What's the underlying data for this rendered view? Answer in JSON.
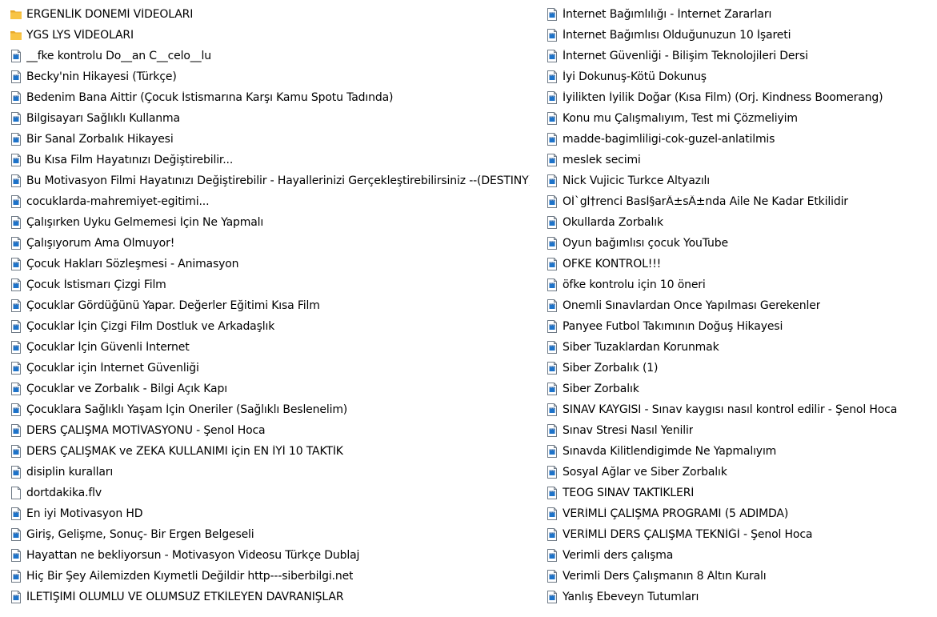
{
  "colors": {
    "folder": "#F8C445",
    "video_icon": "#1E73C9"
  },
  "files_left": [
    {
      "name": "ERGENLİK DÖNEMİ VİDEOLARI",
      "icon": "folder-icon"
    },
    {
      "name": "YGS LYS VİDEOLARI",
      "icon": "folder-icon"
    },
    {
      "name": "__fke kontrolu Do__an C__celo__lu",
      "icon": "video-file-icon"
    },
    {
      "name": "Becky'nin Hikayesi (Türkçe)",
      "icon": "video-file-icon"
    },
    {
      "name": "Bedenim Bana Aittir (Çocuk İstismarına Karşı Kamu Spotu Tadında)",
      "icon": "video-file-icon"
    },
    {
      "name": "Bilgisayarı Sağlıklı Kullanma",
      "icon": "video-file-icon"
    },
    {
      "name": "Bir Sanal Zorbalık Hikayesi",
      "icon": "video-file-icon"
    },
    {
      "name": "Bu Kısa Film Hayatınızı Değiştirebilir...",
      "icon": "video-file-icon"
    },
    {
      "name": "Bu Motivasyon Filmi Hayatınızı Değiştirebilir - Hayallerinizi Gerçekleştirebilirsiniz --(DESTINY)-",
      "icon": "video-file-icon"
    },
    {
      "name": "cocuklarda-mahremiyet-egitimi...",
      "icon": "video-file-icon"
    },
    {
      "name": "Çalışırken Uyku Gelmemesi İçin Ne Yapmalı",
      "icon": "video-file-icon"
    },
    {
      "name": "Çalışıyorum Ama Olmuyor!",
      "icon": "video-file-icon"
    },
    {
      "name": "Çocuk Hakları Sözleşmesi - Animasyon",
      "icon": "video-file-icon"
    },
    {
      "name": "Çocuk İstismarı Çizgi Film",
      "icon": "video-file-icon"
    },
    {
      "name": "Çocuklar Gördüğünü Yapar. Değerler Eğitimi Kısa Film",
      "icon": "video-file-icon"
    },
    {
      "name": "Çocuklar İçin Çizgi Film Dostluk ve Arkadaşlık",
      "icon": "video-file-icon"
    },
    {
      "name": "Çocuklar İçin Güvenli İnternet",
      "icon": "video-file-icon"
    },
    {
      "name": "Çocuklar için İnternet Güvenliği",
      "icon": "video-file-icon"
    },
    {
      "name": "Çocuklar ve Zorbalık - Bilgi Açık Kapı",
      "icon": "video-file-icon"
    },
    {
      "name": "Çocuklara Sağlıklı Yaşam İçin Öneriler (Sağlıklı Beslenelim)",
      "icon": "video-file-icon"
    },
    {
      "name": "DERS ÇALIŞMA MOTİVASYONU - Şenol Hoca",
      "icon": "video-file-icon"
    },
    {
      "name": "DERS ÇALIŞMAK ve ZEKA KULLANIMI için EN İYİ 10 TAKTİK",
      "icon": "video-file-icon"
    },
    {
      "name": "disiplin kuralları",
      "icon": "video-file-icon"
    },
    {
      "name": "dortdakika.flv",
      "icon": "blank-file-icon"
    },
    {
      "name": "En iyi Motivasyon HD",
      "icon": "video-file-icon"
    },
    {
      "name": "Giriş, Gelişme, Sonuç- Bir Ergen Belgeseli",
      "icon": "video-file-icon"
    },
    {
      "name": "Hayattan ne bekliyorsun  - Motivasyon Videosu Türkçe Dublaj",
      "icon": "video-file-icon"
    },
    {
      "name": "Hiç Bir Şey Ailemizden Kıymetli Değildir http---siberbilgi.net",
      "icon": "video-file-icon"
    },
    {
      "name": "İLETİŞİMİ OLUMLU VE OLUMSUZ ETKİLEYEN DAVRANIŞLAR",
      "icon": "video-file-icon"
    }
  ],
  "files_right": [
    {
      "name": "İnternet Bağımlılığı - İnternet Zararları",
      "icon": "video-file-icon"
    },
    {
      "name": "İnternet Bağımlısı Olduğunuzun 10 İşareti",
      "icon": "video-file-icon"
    },
    {
      "name": "İnternet Güvenliği - Bilişim Teknolojileri Dersi",
      "icon": "video-file-icon"
    },
    {
      "name": "İyi Dokunuş-Kötü Dokunuş",
      "icon": "video-file-icon"
    },
    {
      "name": "İyilikten İyilik Doğar (Kısa Film)  (Orj. Kindness Boomerang)",
      "icon": "video-file-icon"
    },
    {
      "name": "Konu mu Çalışmalıyım, Test mi Çözmeliyim",
      "icon": "video-file-icon"
    },
    {
      "name": "madde-bagimliligi-cok-guzel-anlatilmis",
      "icon": "video-file-icon"
    },
    {
      "name": "meslek secimi",
      "icon": "video-file-icon"
    },
    {
      "name": "Nick Vujicic Turkce Altyazılı",
      "icon": "video-file-icon"
    },
    {
      "name": "Oİ`gİ†renci BasÌ§arÄ±sÄ±nda Aile Ne Kadar Etkilidir",
      "icon": "video-file-icon"
    },
    {
      "name": "Okullarda Zorbalık",
      "icon": "video-file-icon"
    },
    {
      "name": "Oyun bağımlısı çocuk  YouTube",
      "icon": "video-file-icon"
    },
    {
      "name": "ÖFKE KONTROL!!!",
      "icon": "video-file-icon"
    },
    {
      "name": "öfke kontrolu için 10 öneri",
      "icon": "video-file-icon"
    },
    {
      "name": "Önemli Sınavlardan Önce Yapılması Gerekenler",
      "icon": "video-file-icon"
    },
    {
      "name": "Panyee Futbol Takımının Doğuş Hikayesi",
      "icon": "video-file-icon"
    },
    {
      "name": "Siber Tuzaklardan Korunmak",
      "icon": "video-file-icon"
    },
    {
      "name": "Siber Zorbalık (1)",
      "icon": "video-file-icon"
    },
    {
      "name": "Siber Zorbalık",
      "icon": "video-file-icon"
    },
    {
      "name": "SINAV KAYGISI - Sınav kaygısı nasıl kontrol edilir - Şenol Hoca",
      "icon": "video-file-icon"
    },
    {
      "name": "Sınav Stresi Nasıl Yenilir",
      "icon": "video-file-icon"
    },
    {
      "name": "Sınavda Kilitlendigimde Ne Yapmalıyım",
      "icon": "video-file-icon"
    },
    {
      "name": "Sosyal Ağlar ve Siber Zorbalık",
      "icon": "video-file-icon"
    },
    {
      "name": "TEOG SINAV TAKTİKLERİ",
      "icon": "video-file-icon"
    },
    {
      "name": "VERİMLİ ÇALIŞMA PROGRAMI (5 ADIMDA)",
      "icon": "video-file-icon"
    },
    {
      "name": "VERİMLİ DERS ÇALIŞMA TEKNİĞİ - Şenol Hoca",
      "icon": "video-file-icon"
    },
    {
      "name": "Verimli ders çalışma",
      "icon": "video-file-icon"
    },
    {
      "name": "Verimli Ders Çalışmanın 8 Altın Kuralı",
      "icon": "video-file-icon"
    },
    {
      "name": "Yanlış Ebeveyn Tutumları",
      "icon": "video-file-icon"
    }
  ]
}
